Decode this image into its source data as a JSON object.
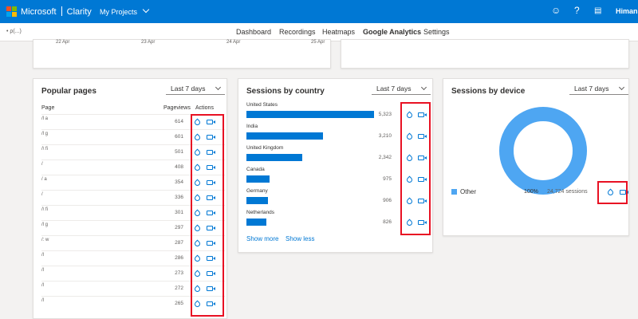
{
  "header": {
    "brand_left": "Microsoft",
    "brand_right": "Clarity",
    "projects": "My Projects",
    "user": "Himans"
  },
  "subnav": {
    "project": "• ρ(...)",
    "tabs": [
      {
        "label": "Dashboard"
      },
      {
        "label": "Recordings"
      },
      {
        "label": "Heatmaps"
      },
      {
        "label": "Google Analytics"
      },
      {
        "label": "Settings"
      }
    ]
  },
  "top_dates": [
    "22 Apr",
    "23 Apr",
    "24 Apr",
    "25 Apr"
  ],
  "popular_pages": {
    "title": "Popular pages",
    "range": "Last 7 days",
    "col_page": "Page",
    "col_views": "Pageviews",
    "col_actions": "Actions",
    "rows": [
      {
        "page": "/l a",
        "views": "614"
      },
      {
        "page": "/l g",
        "views": "601"
      },
      {
        "page": "/\\ fi",
        "views": "501"
      },
      {
        "page": "/",
        "views": "408"
      },
      {
        "page": "/ a",
        "views": "354"
      },
      {
        "page": "/",
        "views": "336"
      },
      {
        "page": "/\\ fi",
        "views": "301"
      },
      {
        "page": "/l g",
        "views": "297"
      },
      {
        "page": "/: w",
        "views": "287"
      },
      {
        "page": "/l",
        "views": "286"
      },
      {
        "page": "/l",
        "views": "273"
      },
      {
        "page": "/l",
        "views": "272"
      },
      {
        "page": "/l",
        "views": "265"
      }
    ]
  },
  "country": {
    "title": "Sessions by country",
    "range": "Last 7 days",
    "rows": [
      {
        "name": "United States",
        "value": "5,323",
        "share": 1.0
      },
      {
        "name": "India",
        "value": "3,210",
        "share": 0.603
      },
      {
        "name": "United Kingdom",
        "value": "2,342",
        "share": 0.44
      },
      {
        "name": "Canada",
        "value": "975",
        "share": 0.183
      },
      {
        "name": "Germany",
        "value": "906",
        "share": 0.17
      },
      {
        "name": "Netherlands",
        "value": "826",
        "share": 0.155
      }
    ],
    "show_more": "Show more",
    "show_less": "Show less"
  },
  "device": {
    "title": "Sessions by device",
    "range": "Last 7 days",
    "legend": "Other",
    "percent": "100%",
    "sessions": "24,724 sessions"
  },
  "colors": {
    "accent": "#0078d4",
    "donut": "#4ea6f2",
    "highlight": "#e81123"
  }
}
